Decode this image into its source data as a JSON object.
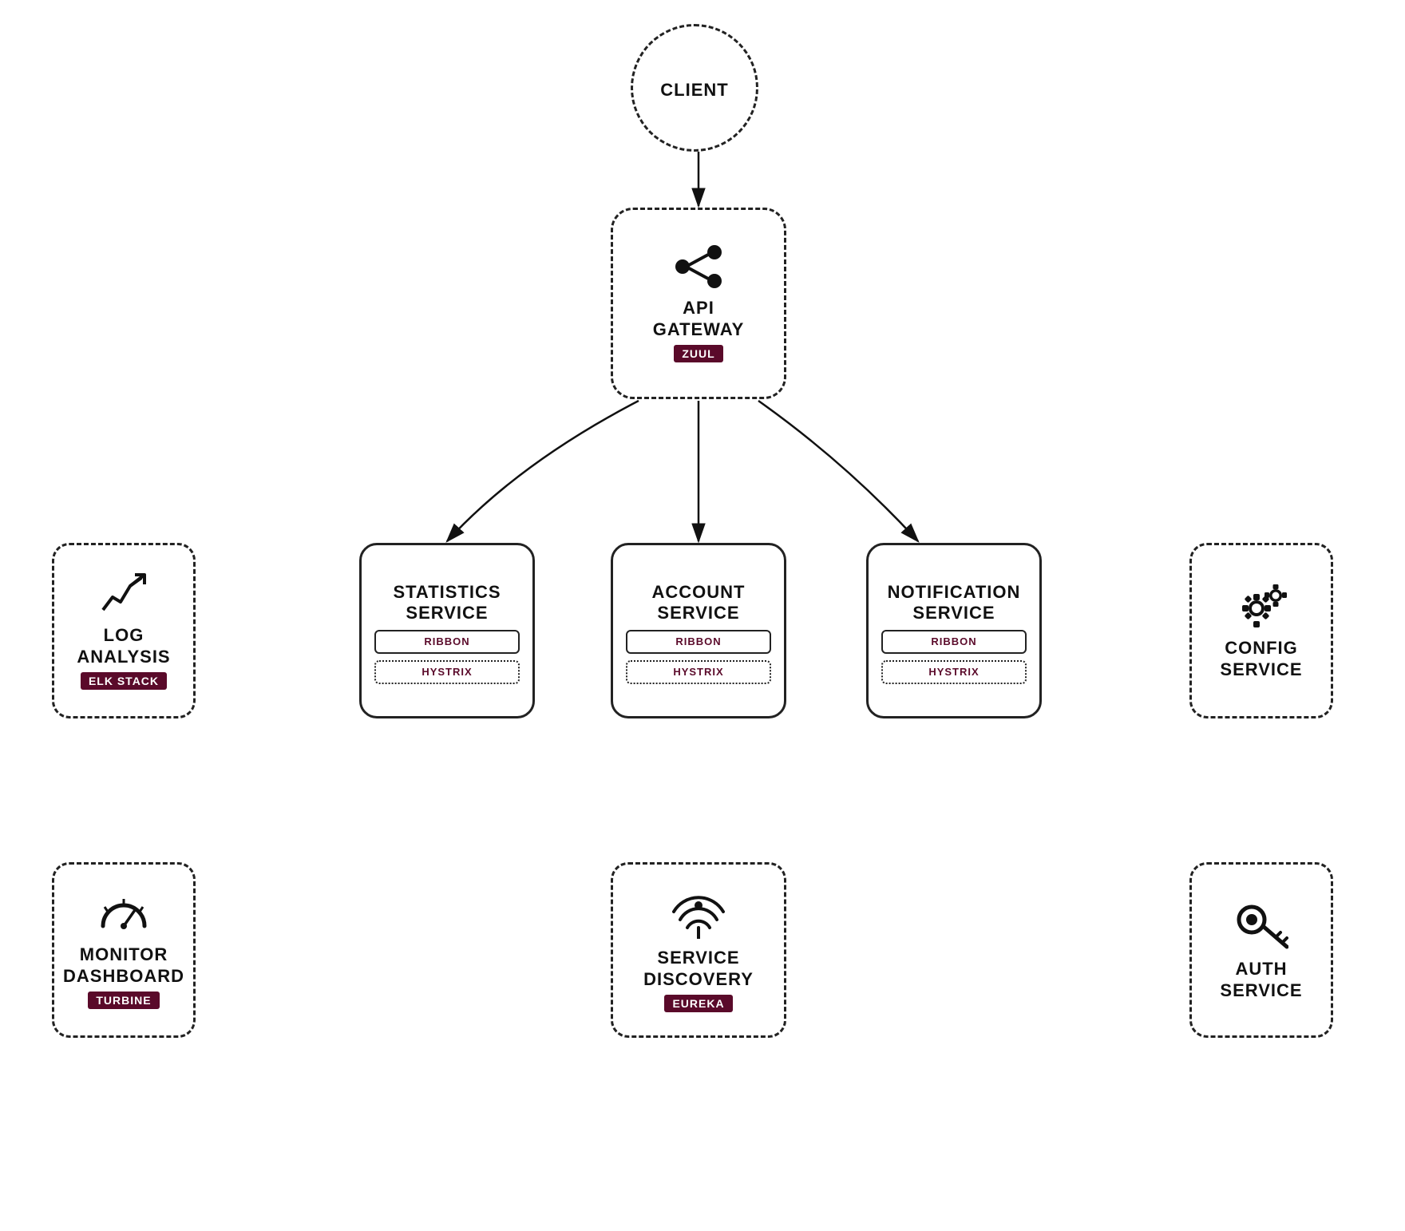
{
  "client": {
    "label": "CLIENT"
  },
  "gateway": {
    "label": "API\nGATEWAY",
    "badge": "ZUUL"
  },
  "log_analysis": {
    "label": "LOG\nANALYSIS",
    "badge": "ELK STACK"
  },
  "stats_service": {
    "label": "STATISTICS\nSERVICE",
    "ribbon": "RIBBON",
    "hystrix": "HYSTRIX"
  },
  "account_service": {
    "label": "ACCOUNT\nSERVICE",
    "ribbon": "RIBBON",
    "hystrix": "HYSTRIX"
  },
  "notification_service": {
    "label": "NOTIFICATION\nSERVICE",
    "ribbon": "RIBBON",
    "hystrix": "HYSTRIX"
  },
  "config_service": {
    "label": "CONFIG\nSERVICE"
  },
  "monitor_dashboard": {
    "label": "MONITOR\nDASHBOARD",
    "badge": "TURBINE"
  },
  "service_discovery": {
    "label": "SERVICE\nDISCOVERY",
    "badge": "EUREKA"
  },
  "auth_service": {
    "label": "AUTH\nSERVICE"
  }
}
